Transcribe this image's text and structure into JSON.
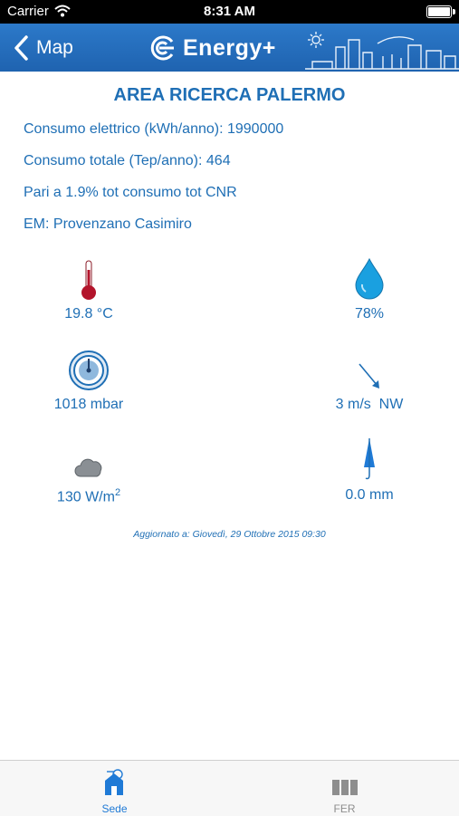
{
  "status_bar": {
    "carrier": "Carrier",
    "time": "8:31 AM"
  },
  "nav": {
    "back_label": "Map",
    "app_title": "Energy+"
  },
  "area": {
    "title": "AREA RICERCA PALERMO",
    "lines": [
      "Consumo elettrico (kWh/anno): 1990000",
      "Consumo totale (Tep/anno): 464",
      "Pari a 1.9% tot consumo tot CNR",
      "EM: Provenzano Casimiro"
    ]
  },
  "weather": {
    "temperature": "19.8 °C",
    "humidity": "78%",
    "pressure": "1018 mbar",
    "wind": "3 m/s  NW",
    "radiation": "130 W/m",
    "radiation_exp": "2",
    "rain": "0.0 mm"
  },
  "updated": "Aggiornato a: Giovedì, 29 Ottobre 2015 09:30",
  "tabs": [
    {
      "label": "Sede",
      "active": true
    },
    {
      "label": "FER",
      "active": false
    }
  ],
  "colors": {
    "accent": "#1f6fb5",
    "nav": "#2670c0",
    "thermometer": "#b3142b",
    "drop": "#1aa0e0"
  }
}
